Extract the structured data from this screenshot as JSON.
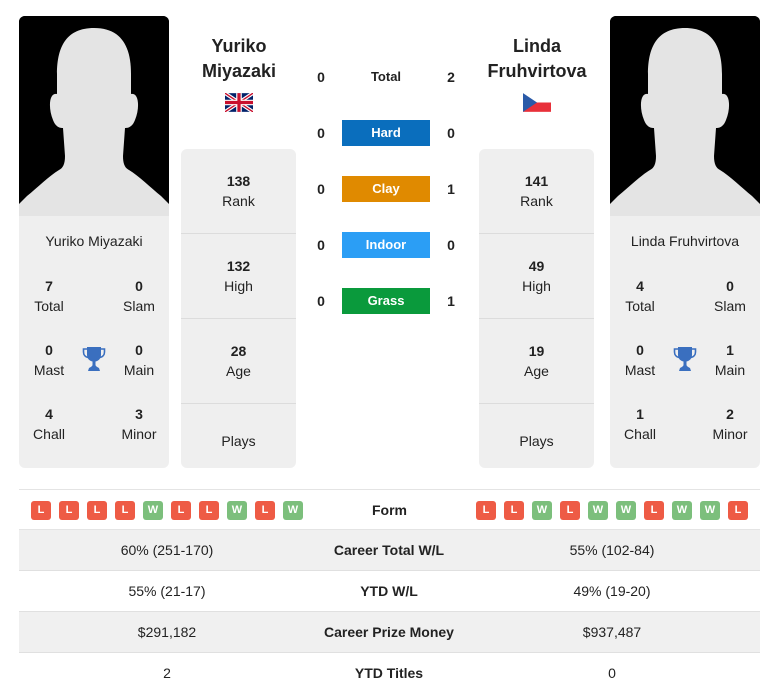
{
  "players": [
    {
      "name_line1": "Yuriko",
      "name_line2": "Miyazaki",
      "full_name": "Yuriko Miyazaki",
      "flag": "gb-flag",
      "titles": {
        "total": {
          "value": "7",
          "label": "Total"
        },
        "slam": {
          "value": "0",
          "label": "Slam"
        },
        "mast": {
          "value": "0",
          "label": "Mast"
        },
        "main": {
          "value": "0",
          "label": "Main"
        },
        "chall": {
          "value": "4",
          "label": "Chall"
        },
        "minor": {
          "value": "3",
          "label": "Minor"
        }
      },
      "rank": {
        "value": "138",
        "label": "Rank"
      },
      "high": {
        "value": "132",
        "label": "High"
      },
      "age": {
        "value": "28",
        "label": "Age"
      },
      "plays": {
        "value": "",
        "label": "Plays"
      },
      "form": [
        "L",
        "L",
        "L",
        "L",
        "W",
        "L",
        "L",
        "W",
        "L",
        "W"
      ]
    },
    {
      "name_line1": "Linda",
      "name_line2": "Fruhvirtova",
      "full_name": "Linda Fruhvirtova",
      "flag": "cz-flag",
      "titles": {
        "total": {
          "value": "4",
          "label": "Total"
        },
        "slam": {
          "value": "0",
          "label": "Slam"
        },
        "mast": {
          "value": "0",
          "label": "Mast"
        },
        "main": {
          "value": "1",
          "label": "Main"
        },
        "chall": {
          "value": "1",
          "label": "Chall"
        },
        "minor": {
          "value": "2",
          "label": "Minor"
        }
      },
      "rank": {
        "value": "141",
        "label": "Rank"
      },
      "high": {
        "value": "49",
        "label": "High"
      },
      "age": {
        "value": "19",
        "label": "Age"
      },
      "plays": {
        "value": "",
        "label": "Plays"
      },
      "form": [
        "L",
        "L",
        "W",
        "L",
        "W",
        "W",
        "L",
        "W",
        "W",
        "L"
      ]
    }
  ],
  "h2h": [
    {
      "surface": "Total",
      "p1": "0",
      "p2": "2",
      "color": ""
    },
    {
      "surface": "Hard",
      "p1": "0",
      "p2": "0",
      "color": "#0a6ebd"
    },
    {
      "surface": "Clay",
      "p1": "0",
      "p2": "1",
      "color": "#e08a00"
    },
    {
      "surface": "Indoor",
      "p1": "0",
      "p2": "0",
      "color": "#2b9ef5"
    },
    {
      "surface": "Grass",
      "p1": "0",
      "p2": "1",
      "color": "#0a9a3c"
    }
  ],
  "form_label": "Form",
  "stats": [
    {
      "label": "Career Total W/L",
      "p1": "60% (251-170)",
      "p2": "55% (102-84)"
    },
    {
      "label": "YTD W/L",
      "p1": "55% (21-17)",
      "p2": "49% (19-20)"
    },
    {
      "label": "Career Prize Money",
      "p1": "$291,182",
      "p2": "$937,487"
    },
    {
      "label": "YTD Titles",
      "p1": "2",
      "p2": "0"
    }
  ],
  "colors": {
    "loss": "#ee5b45",
    "win": "#7cbf7c",
    "trophy": "#3a6fbf"
  }
}
